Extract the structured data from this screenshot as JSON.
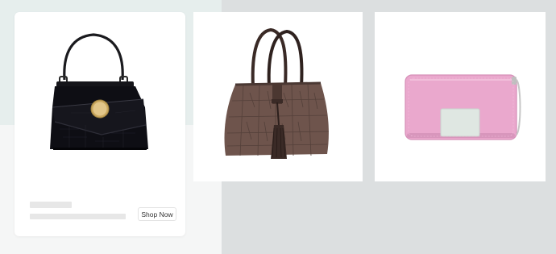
{
  "colors": {
    "page_background": "#dcdfe0",
    "card_background": "#ffffff",
    "skeleton": "#e7e7e7"
  },
  "products": [
    {
      "image": "black-leather-handbag",
      "title_placeholder": "",
      "shop_button_label": "Shop Now"
    },
    {
      "image": "brown-croc-tote-with-tassel"
    },
    {
      "image": "pink-zip-wallet"
    }
  ]
}
